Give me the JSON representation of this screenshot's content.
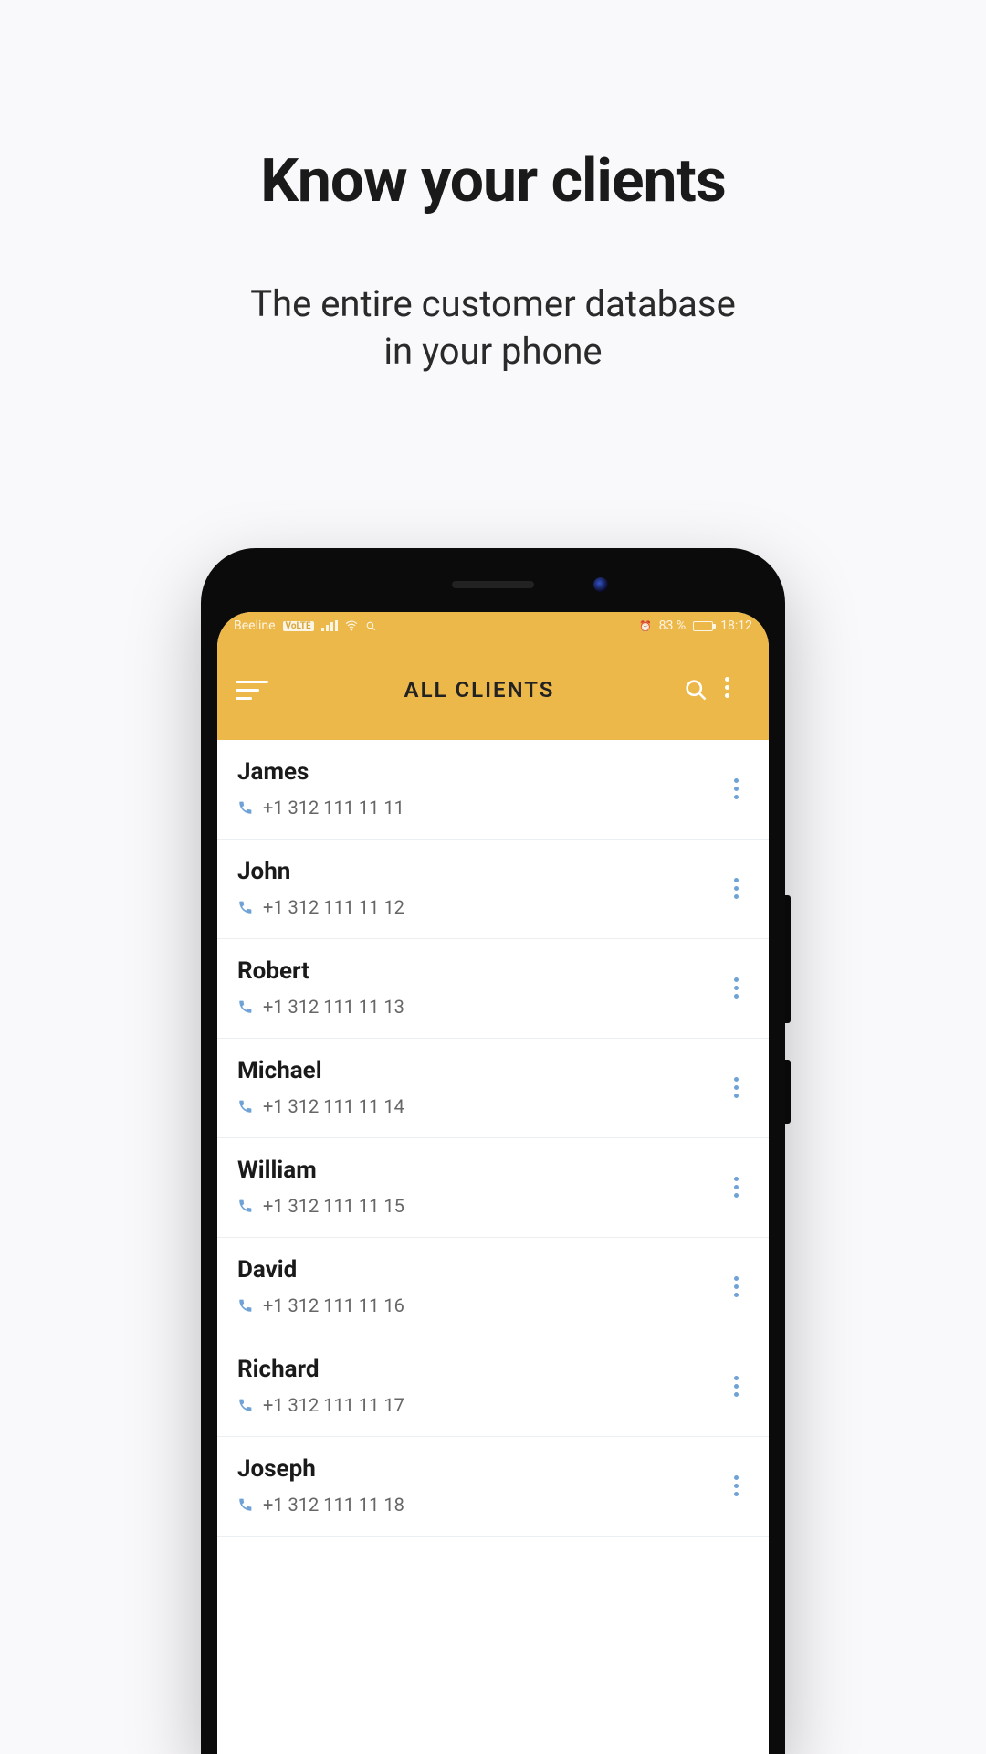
{
  "marketing": {
    "headline": "Know your clients",
    "subhead_line1": "The entire customer database",
    "subhead_line2": "in your phone"
  },
  "status": {
    "carrier": "Beeline",
    "carrier_badge": "VoLTE",
    "battery_text": "83 %",
    "time": "18:12",
    "alarm_glyph": "⏰"
  },
  "appbar": {
    "title": "ALL CLIENTS"
  },
  "clients": [
    {
      "name": "James",
      "phone": "+1 312 111 11 11"
    },
    {
      "name": "John",
      "phone": "+1 312 111 11 12"
    },
    {
      "name": "Robert",
      "phone": "+1 312 111 11 13"
    },
    {
      "name": "Michael",
      "phone": "+1 312 111 11 14"
    },
    {
      "name": "William",
      "phone": "+1 312 111 11 15"
    },
    {
      "name": "David",
      "phone": "+1 312 111 11 16"
    },
    {
      "name": "Richard",
      "phone": "+1 312 111 11 17"
    },
    {
      "name": "Joseph",
      "phone": "+1 312 111 11 18"
    }
  ],
  "colors": {
    "accent": "#edb84a",
    "row_icon": "#6fa2d6"
  }
}
